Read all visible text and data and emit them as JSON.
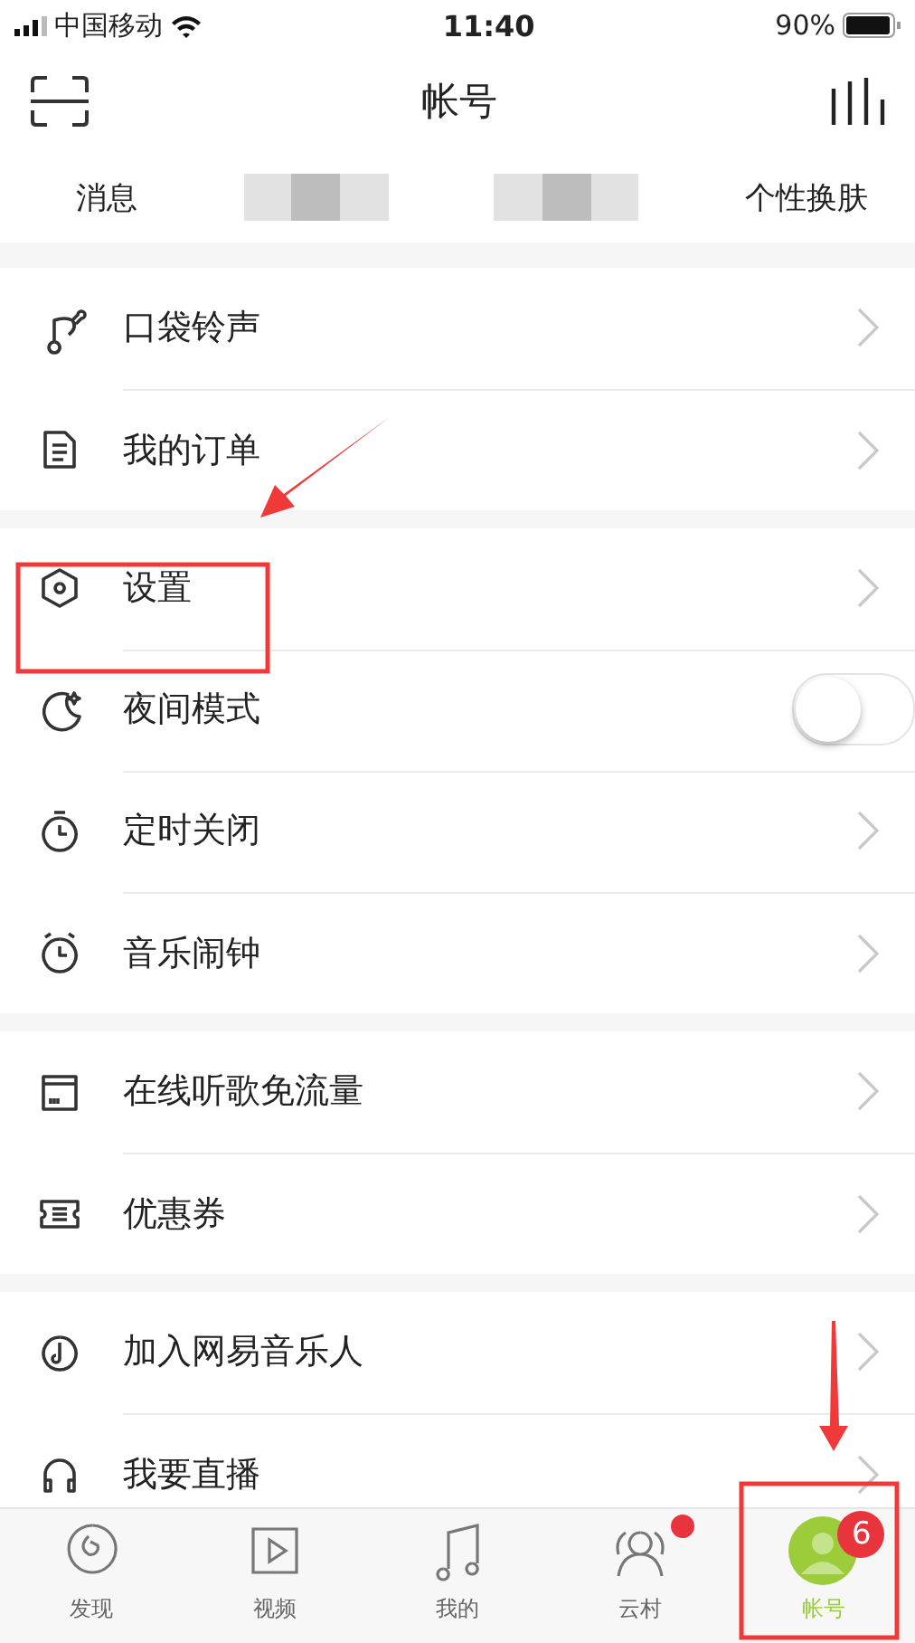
{
  "status_bar": {
    "carrier": "中国移动",
    "time": "11:40",
    "battery": "90%"
  },
  "header": {
    "title": "帐号"
  },
  "top_links": [
    {
      "kind": "text",
      "label": "消息"
    },
    {
      "kind": "redacted"
    },
    {
      "kind": "redacted"
    },
    {
      "kind": "text",
      "label": "个性换肤"
    }
  ],
  "sections": [
    {
      "items": [
        {
          "label": "口袋铃声",
          "kind": "link"
        },
        {
          "label": "我的订单",
          "kind": "link"
        }
      ]
    },
    {
      "items": [
        {
          "label": "设置",
          "kind": "link"
        },
        {
          "label": "夜间模式",
          "kind": "toggle",
          "on": false
        },
        {
          "label": "定时关闭",
          "kind": "link"
        },
        {
          "label": "音乐闹钟",
          "kind": "link"
        }
      ]
    },
    {
      "items": [
        {
          "label": "在线听歌免流量",
          "kind": "link"
        },
        {
          "label": "优惠券",
          "kind": "link"
        }
      ]
    },
    {
      "items": [
        {
          "label": "加入网易音乐人",
          "kind": "link"
        },
        {
          "label": "我要直播",
          "kind": "link"
        }
      ]
    }
  ],
  "tab_bar": [
    {
      "label": "发现",
      "selected": false,
      "dot": false
    },
    {
      "label": "视频",
      "selected": false,
      "dot": false
    },
    {
      "label": "我的",
      "selected": false,
      "dot": false
    },
    {
      "label": "云村",
      "selected": false,
      "dot": true
    },
    {
      "label": "帐号",
      "selected": true,
      "dot": false,
      "badge": "6"
    }
  ],
  "annotations": [
    {
      "kind": "arrow"
    },
    {
      "kind": "box"
    },
    {
      "kind": "arrow"
    },
    {
      "kind": "box"
    }
  ]
}
